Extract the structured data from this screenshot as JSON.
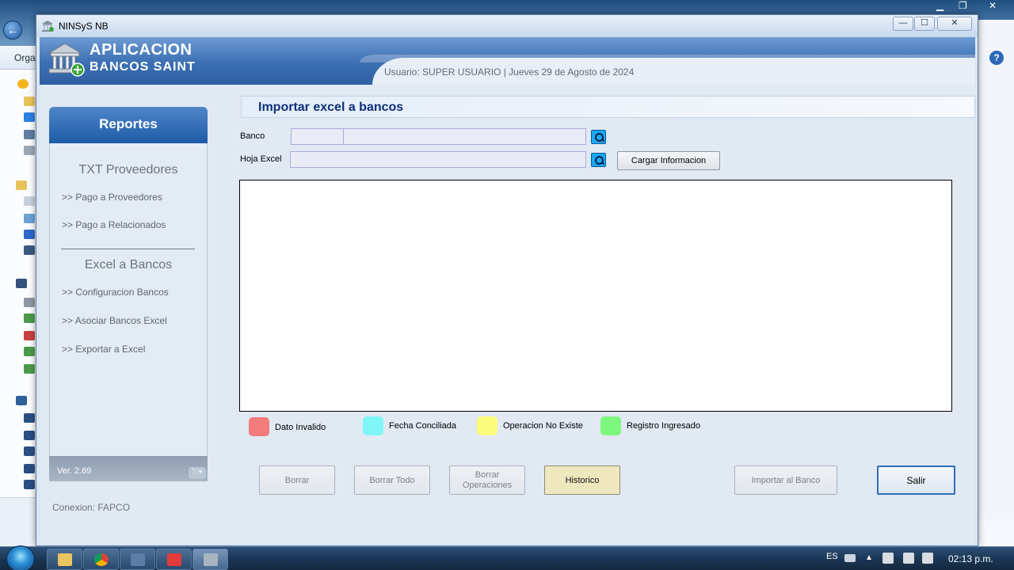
{
  "background": {
    "explorer_organize_label": "Orga"
  },
  "window": {
    "title": "NINSyS NB",
    "minimize": "—",
    "maximize": "☐",
    "close": "✕"
  },
  "header": {
    "app_name_line1": "APLICACION",
    "app_name_line2": "BANCOS  SAINT",
    "user_info": "Usuario: SUPER USUARIO  |  Jueves 29 de Agosto de 2024"
  },
  "sidebar": {
    "title": "Reportes",
    "section1": "TXT Proveedores",
    "section1_links": [
      ">> Pago a Proveedores",
      ">> Pago a Relacionados"
    ],
    "section2": "Excel a Bancos",
    "section2_links": [
      ">> Configuracion Bancos",
      ">> Asociar Bancos Excel",
      ">> Exportar a Excel"
    ],
    "version": "Ver.  2.69",
    "conexion": "Conexion: FAPCO"
  },
  "main": {
    "title": "Importar excel a bancos",
    "banco_label": "Banco",
    "banco_code": "",
    "banco_name": "",
    "hoja_label": "Hoja Excel",
    "hoja_value": "",
    "cargar_button": "Cargar Informacion"
  },
  "legend": [
    {
      "label": "Dato Invalido",
      "color": "#f47c7c"
    },
    {
      "label": "Fecha Conciliada",
      "color": "#7ff7f7"
    },
    {
      "label": "Operacion No Existe",
      "color": "#fbfb7c"
    },
    {
      "label": "Registro Ingresado",
      "color": "#7ef77e"
    }
  ],
  "buttons": {
    "borrar": "Borrar",
    "borrar_todo": "Borrar Todo",
    "borrar_operaciones_line1": "Borrar",
    "borrar_operaciones_line2": "Operaciones",
    "historico": "Historico",
    "importar": "Importar al Banco",
    "salir": "Salir"
  },
  "taskbar": {
    "language": "ES",
    "time": "02:13 p.m."
  },
  "colors": {
    "header_blue": "#2f5fa3",
    "title_navy": "#0d2f7a",
    "historico_bg": "#efe8bf"
  }
}
